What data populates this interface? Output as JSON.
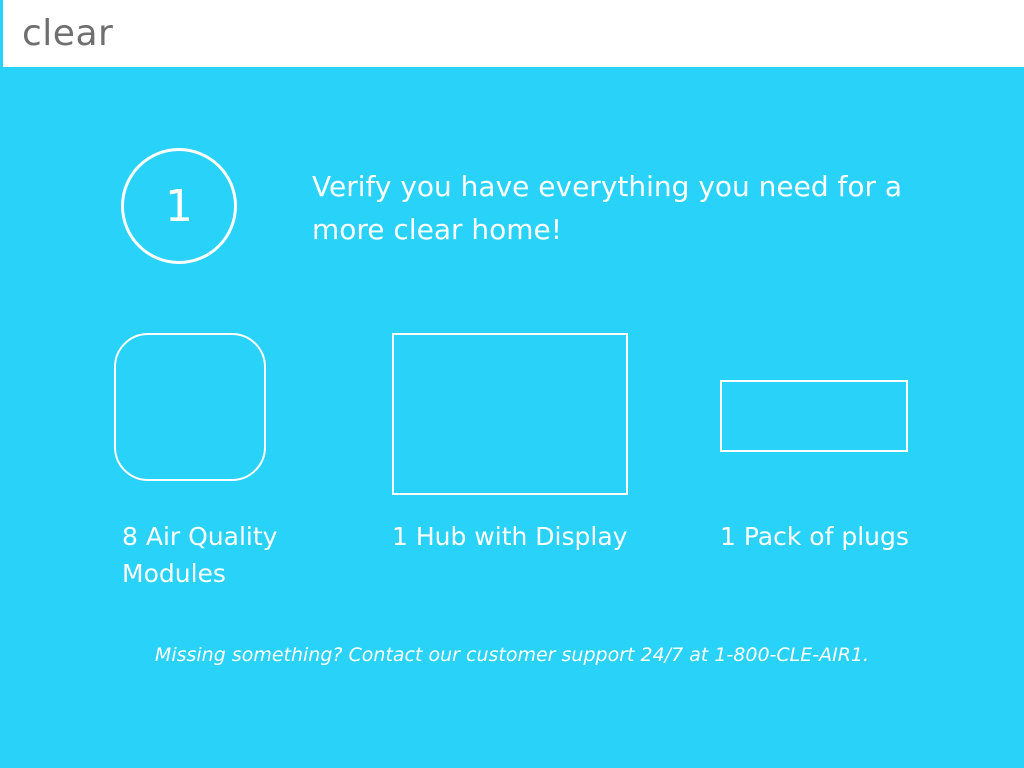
{
  "header": {
    "brand": "clear"
  },
  "step": {
    "number": "1",
    "headline": "Verify you have everything you need for a more clear home!"
  },
  "products": [
    {
      "label": "8 Air Quality Modules"
    },
    {
      "label": "1 Hub with Display"
    },
    {
      "label": "1 Pack of plugs"
    }
  ],
  "support_text": "Missing something? Contact our customer support 24/7 at 1-800-CLE-AIR1.",
  "colors": {
    "background": "#29d2f9",
    "header_bg": "#ffffff",
    "brand_text": "#6f6f6f",
    "foreground": "#ffffff"
  }
}
